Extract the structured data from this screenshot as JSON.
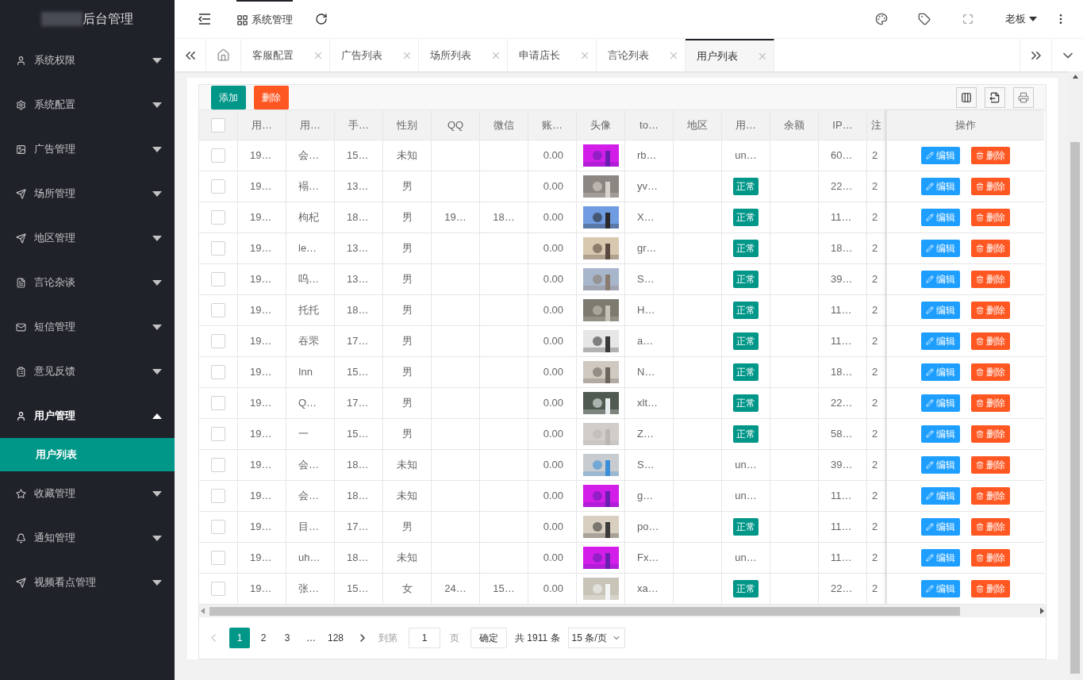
{
  "sidebar": {
    "title": "后台管理",
    "items": [
      {
        "label": "系统权限",
        "expanded": false
      },
      {
        "label": "系统配置",
        "expanded": false
      },
      {
        "label": "广告管理",
        "expanded": false
      },
      {
        "label": "场所管理",
        "expanded": false
      },
      {
        "label": "地区管理",
        "expanded": false
      },
      {
        "label": "言论杂谈",
        "expanded": false
      },
      {
        "label": "短信管理",
        "expanded": false
      },
      {
        "label": "意见反馈",
        "expanded": false
      },
      {
        "label": "用户管理",
        "expanded": true,
        "children": [
          {
            "label": "用户列表",
            "selected": true
          }
        ]
      },
      {
        "label": "收藏管理",
        "expanded": false
      },
      {
        "label": "通知管理",
        "expanded": false
      },
      {
        "label": "视频看点管理",
        "expanded": false
      }
    ]
  },
  "header": {
    "module": "系统管理",
    "user": "老板"
  },
  "tabs": [
    {
      "label": "客服配置",
      "selected": false
    },
    {
      "label": "广告列表",
      "selected": false
    },
    {
      "label": "场所列表",
      "selected": false
    },
    {
      "label": "申请店长",
      "selected": false
    },
    {
      "label": "言论列表",
      "selected": false
    },
    {
      "label": "用户列表",
      "selected": true
    }
  ],
  "toolbar": {
    "buttons": [
      "添加",
      "删除"
    ]
  },
  "table": {
    "header_checked": false,
    "columns": [
      "用…",
      "用…",
      "手…",
      "性别",
      "QQ",
      "微信",
      "账…",
      "头像",
      "to…",
      "地区",
      "用…",
      "余额",
      "IP…",
      "注"
    ],
    "action_column": "操作",
    "rows": [
      {
        "checked": false,
        "id": "19…",
        "name": "会…",
        "phone": "15…",
        "gender": "未知",
        "balance": "0.00",
        "token": "rb…",
        "status": {
          "kind": "text",
          "text": "un…"
        },
        "ip": "60…",
        "reg": "2",
        "actions": [
          "编辑",
          "删除"
        ]
      },
      {
        "checked": false,
        "id": "19…",
        "name": "褟…",
        "phone": "13…",
        "gender": "男",
        "balance": "0.00",
        "token": "yv…",
        "status": {
          "kind": "tag",
          "text": "正常"
        },
        "ip": "22…",
        "reg": "2",
        "actions": [
          "编辑",
          "删除"
        ]
      },
      {
        "checked": false,
        "id": "19…",
        "name": "枸杞",
        "phone": "18…",
        "gender": "男",
        "qq": "19…",
        "wechat": "18…",
        "balance": "0.00",
        "token": "X…",
        "status": {
          "kind": "tag",
          "text": "正常"
        },
        "ip": "11…",
        "reg": "2",
        "actions": [
          "编辑",
          "删除"
        ]
      },
      {
        "checked": false,
        "id": "19…",
        "name": "le…",
        "phone": "13…",
        "gender": "男",
        "balance": "0.00",
        "token": "gr…",
        "status": {
          "kind": "tag",
          "text": "正常"
        },
        "ip": "18…",
        "reg": "2",
        "actions": [
          "编辑",
          "删除"
        ]
      },
      {
        "checked": false,
        "id": "19…",
        "name": "呜…",
        "phone": "13…",
        "gender": "男",
        "balance": "0.00",
        "token": "S…",
        "status": {
          "kind": "tag",
          "text": "正常"
        },
        "ip": "39…",
        "reg": "2",
        "actions": [
          "编辑",
          "删除"
        ]
      },
      {
        "checked": false,
        "id": "19…",
        "name": "托托",
        "phone": "18…",
        "gender": "男",
        "balance": "0.00",
        "token": "H…",
        "status": {
          "kind": "tag",
          "text": "正常"
        },
        "ip": "11…",
        "reg": "2",
        "actions": [
          "编辑",
          "删除"
        ]
      },
      {
        "checked": false,
        "id": "19…",
        "name": "吞罘",
        "phone": "17…",
        "gender": "男",
        "balance": "0.00",
        "token": "a…",
        "status": {
          "kind": "tag",
          "text": "正常"
        },
        "ip": "11…",
        "reg": "2",
        "actions": [
          "编辑",
          "删除"
        ]
      },
      {
        "checked": false,
        "id": "19…",
        "name": "Inn",
        "phone": "15…",
        "gender": "男",
        "balance": "0.00",
        "token": "N…",
        "status": {
          "kind": "tag",
          "text": "正常"
        },
        "ip": "18…",
        "reg": "2",
        "actions": [
          "编辑",
          "删除"
        ]
      },
      {
        "checked": false,
        "id": "19…",
        "name": "Q…",
        "phone": "17…",
        "gender": "男",
        "balance": "0.00",
        "token": "xlt…",
        "status": {
          "kind": "tag",
          "text": "正常"
        },
        "ip": "22…",
        "reg": "2",
        "actions": [
          "编辑",
          "删除"
        ]
      },
      {
        "checked": false,
        "id": "19…",
        "name": "一",
        "phone": "15…",
        "gender": "男",
        "balance": "0.00",
        "token": "Z…",
        "status": {
          "kind": "tag",
          "text": "正常"
        },
        "ip": "58…",
        "reg": "2",
        "actions": [
          "编辑",
          "删除"
        ]
      },
      {
        "checked": false,
        "id": "19…",
        "name": "会…",
        "phone": "18…",
        "gender": "未知",
        "balance": "0.00",
        "token": "S…",
        "status": {
          "kind": "text",
          "text": "un…"
        },
        "ip": "39…",
        "reg": "2",
        "actions": [
          "编辑",
          "删除"
        ]
      },
      {
        "checked": false,
        "id": "19…",
        "name": "会…",
        "phone": "18…",
        "gender": "未知",
        "balance": "0.00",
        "token": "g…",
        "status": {
          "kind": "text",
          "text": "un…"
        },
        "ip": "11…",
        "reg": "2",
        "actions": [
          "编辑",
          "删除"
        ]
      },
      {
        "checked": false,
        "id": "19…",
        "name": "目…",
        "phone": "17…",
        "gender": "男",
        "balance": "0.00",
        "token": "po…",
        "status": {
          "kind": "tag",
          "text": "正常"
        },
        "ip": "11…",
        "reg": "2",
        "actions": [
          "编辑",
          "删除"
        ]
      },
      {
        "checked": false,
        "id": "19…",
        "name": "uh…",
        "phone": "18…",
        "gender": "未知",
        "balance": "0.00",
        "token": "Fx…",
        "status": {
          "kind": "text",
          "text": "un…"
        },
        "ip": "11…",
        "reg": "2",
        "actions": [
          "编辑",
          "删除"
        ]
      },
      {
        "checked": false,
        "id": "19…",
        "name": "张…",
        "phone": "15…",
        "gender": "女",
        "qq": "24…",
        "wechat": "15…",
        "balance": "0.00",
        "token": "xa…",
        "status": {
          "kind": "tag",
          "text": "正常"
        },
        "ip": "22…",
        "reg": "2",
        "actions": [
          "编辑",
          "删除"
        ]
      }
    ]
  },
  "pagination": {
    "pages": [
      {
        "label": "1",
        "selected": true
      },
      {
        "label": "2",
        "selected": false
      },
      {
        "label": "3",
        "selected": false
      },
      {
        "label": "…",
        "selected": false
      },
      {
        "label": "128",
        "selected": false
      }
    ],
    "goto_label": "到第",
    "goto_value": "1",
    "page_unit": "页",
    "confirm": "确定",
    "total": "共 1911 条",
    "page_size": "15 条/页"
  }
}
